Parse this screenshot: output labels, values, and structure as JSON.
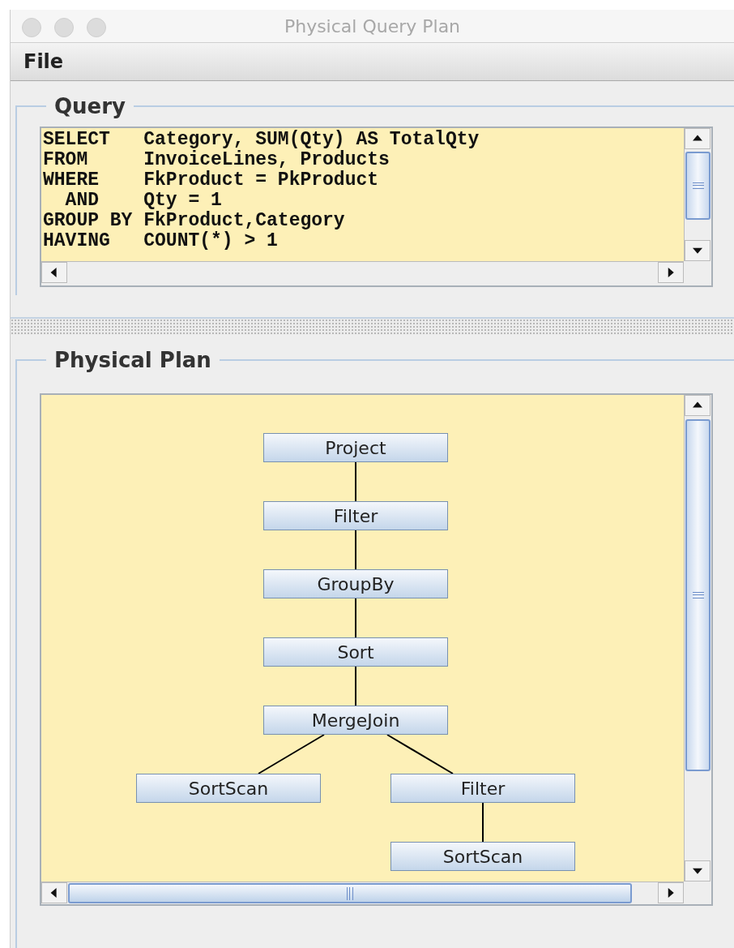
{
  "window": {
    "title": "Physical Query Plan"
  },
  "menu": [
    {
      "label": "File"
    }
  ],
  "query": {
    "title": "Query",
    "lines": [
      "SELECT   Category, SUM(Qty) AS TotalQty",
      "FROM     InvoiceLines, Products",
      "WHERE    FkProduct = PkProduct",
      "  AND    Qty = 1",
      "GROUP BY FkProduct,Category",
      "HAVING   COUNT(*) > 1"
    ]
  },
  "plan": {
    "title": "Physical Plan",
    "tree": {
      "label": "Project",
      "children": [
        {
          "label": "Filter",
          "children": [
            {
              "label": "GroupBy",
              "children": [
                {
                  "label": "Sort",
                  "children": [
                    {
                      "label": "MergeJoin",
                      "children": [
                        {
                          "label": "SortScan"
                        },
                        {
                          "label": "Filter",
                          "children": [
                            {
                              "label": "SortScan"
                            }
                          ]
                        }
                      ]
                    }
                  ]
                }
              ]
            }
          ]
        }
      ]
    }
  }
}
